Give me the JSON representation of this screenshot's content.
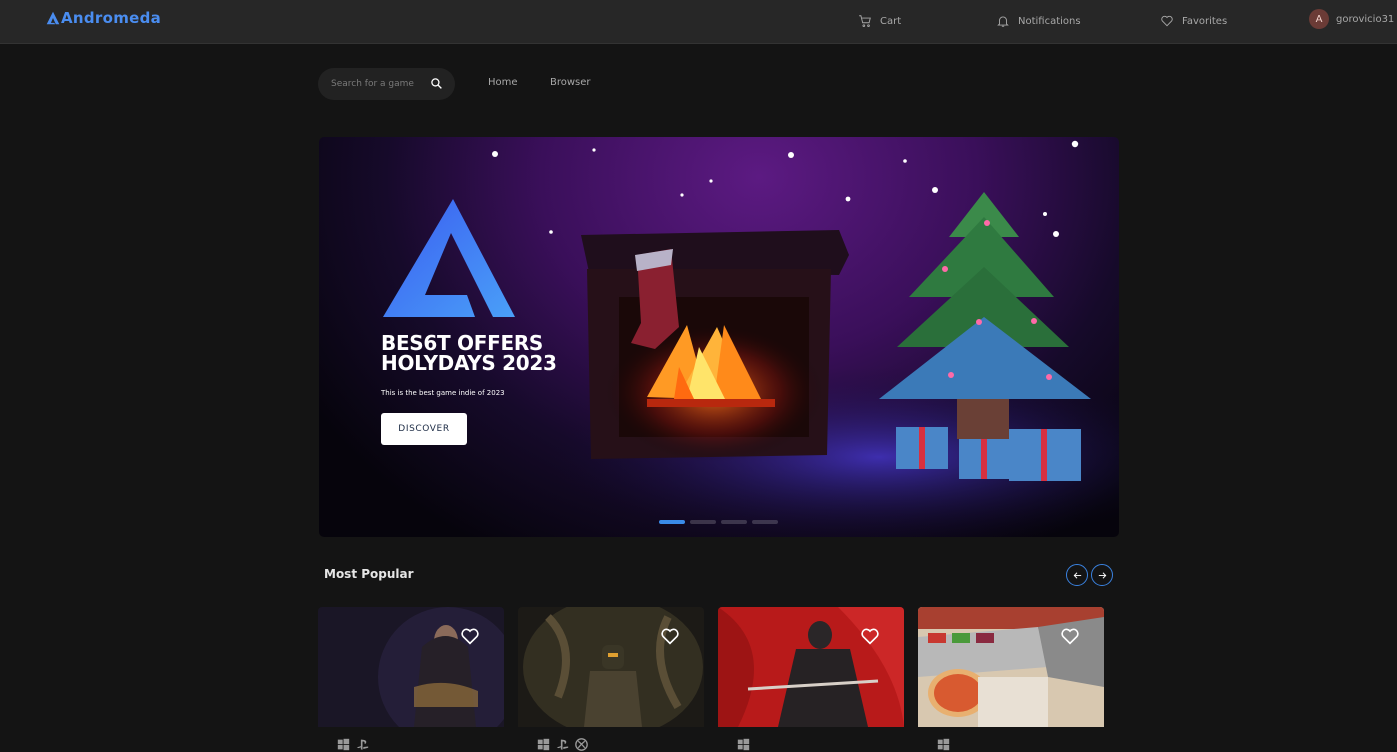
{
  "app": {
    "name": "Andromeda"
  },
  "topbar": {
    "cart_label": "Cart",
    "notifications_label": "Notifications",
    "favorites_label": "Favorites",
    "user": {
      "initial": "A",
      "username": "gorovicio31"
    }
  },
  "search": {
    "placeholder": "Search for a game"
  },
  "menu": {
    "home": "Home",
    "browser": "Browser"
  },
  "hero": {
    "title_line1": "BES6T OFFERS",
    "title_line2": "HOLYDAYS 2023",
    "subtitle": "This is the best game indie of 2023",
    "cta": "DISCOVER",
    "slides_count": 4,
    "active_slide": 1
  },
  "most_popular": {
    "title": "Most Popular",
    "cards": [
      {
        "platforms": [
          "windows-icon",
          "playstation-icon"
        ]
      },
      {
        "platforms": [
          "windows-icon",
          "playstation-icon",
          "xbox-icon"
        ]
      },
      {
        "platforms": [
          "windows-icon"
        ]
      },
      {
        "platforms": [
          "windows-icon"
        ]
      }
    ]
  },
  "colors": {
    "accent": "#3a8be8",
    "logo": "#4a8df0",
    "background": "#141414",
    "topbar": "#272727"
  }
}
